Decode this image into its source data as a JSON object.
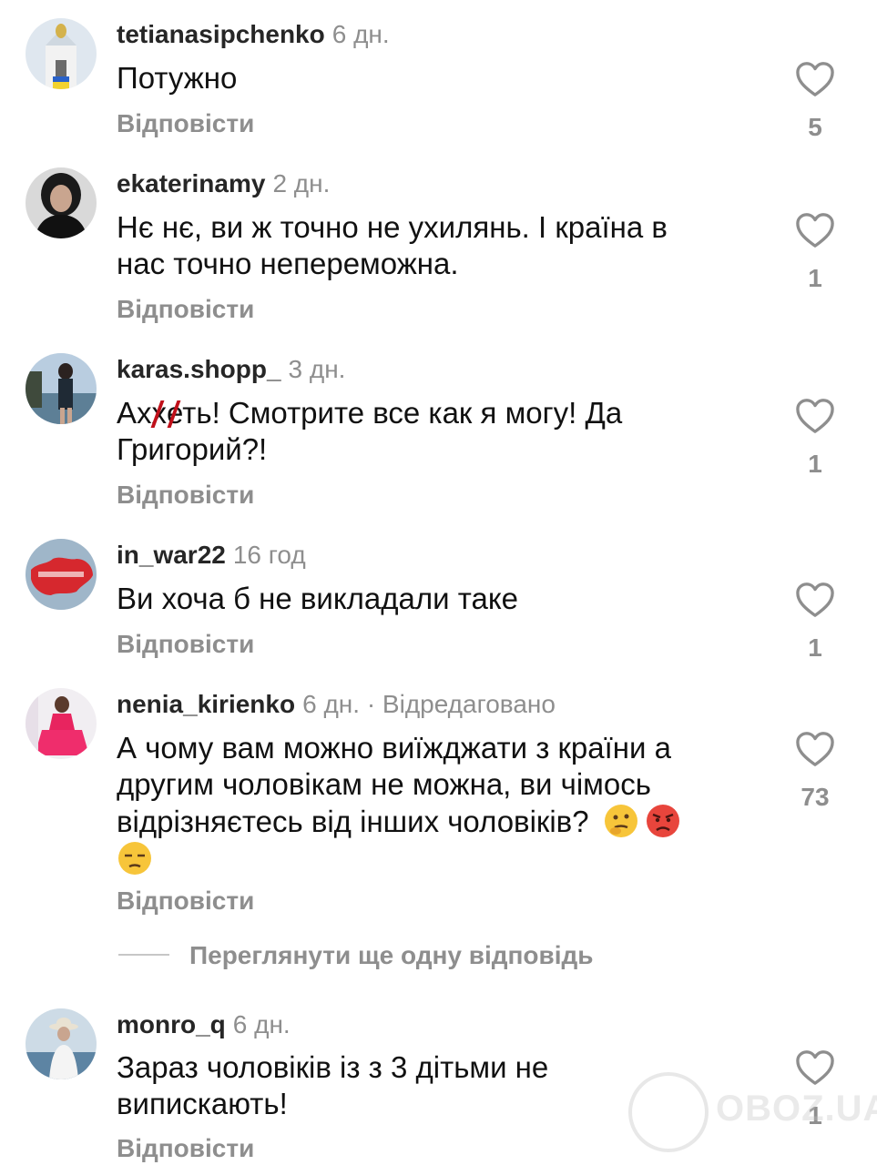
{
  "comments": [
    {
      "username": "tetianasipchenko",
      "time": "6 дн.",
      "text": "Потужно",
      "reply_label": "Відповісти",
      "likes": "5",
      "avatar": "church-avatar"
    },
    {
      "username": "ekaterinamy",
      "time": "2 дн.",
      "text_lines": [
        "Нє нє, ви ж точно не ухилянь. І країна в",
        "нас точно непереможна."
      ],
      "reply_label": "Відповісти",
      "likes": "1",
      "avatar": "portrait-avatar"
    },
    {
      "username": "karas.shopp_",
      "time": "3 дн.",
      "text_a": "Ах",
      "text_censored": "х",
      "text_b": "еть! Смотрите все как я могу! Да",
      "text_line2": "Григорий?!",
      "reply_label": "Відповісти",
      "likes": "1",
      "avatar": "seaside-avatar"
    },
    {
      "username": "in_war22",
      "time": "16 год",
      "text": "Ви хоча б не викладали таке",
      "reply_label": "Відповісти",
      "likes": "1",
      "avatar": "map-avatar"
    },
    {
      "username": "nenia_kirienko",
      "time": "6 дн.",
      "edited": "· Відредаговано",
      "text_lines": [
        "А чому вам можно виїжджати з країни а",
        "другим чоловікам не можна, ви чімось",
        "відрізняєтесь від інших чоловіків?"
      ],
      "emojis": [
        "thinking-face",
        "angry-face",
        "unamused-face"
      ],
      "reply_label": "Відповісти",
      "likes": "73",
      "avatar": "pink-dress-avatar"
    },
    {
      "username": "monro_q",
      "time": "6 дн.",
      "text_lines": [
        "Зараз чоловіків із з 3 дітьми не",
        "випискають!"
      ],
      "reply_label": "Відповісти",
      "likes": "1",
      "avatar": "hat-avatar"
    }
  ],
  "view_more_replies": "Переглянути ще одну відповідь",
  "watermark": "OBOZ.UA",
  "colors": {
    "secondary_text": "#8e8e8e",
    "primary_text": "#111111",
    "censor_mark": "#c0101a"
  }
}
